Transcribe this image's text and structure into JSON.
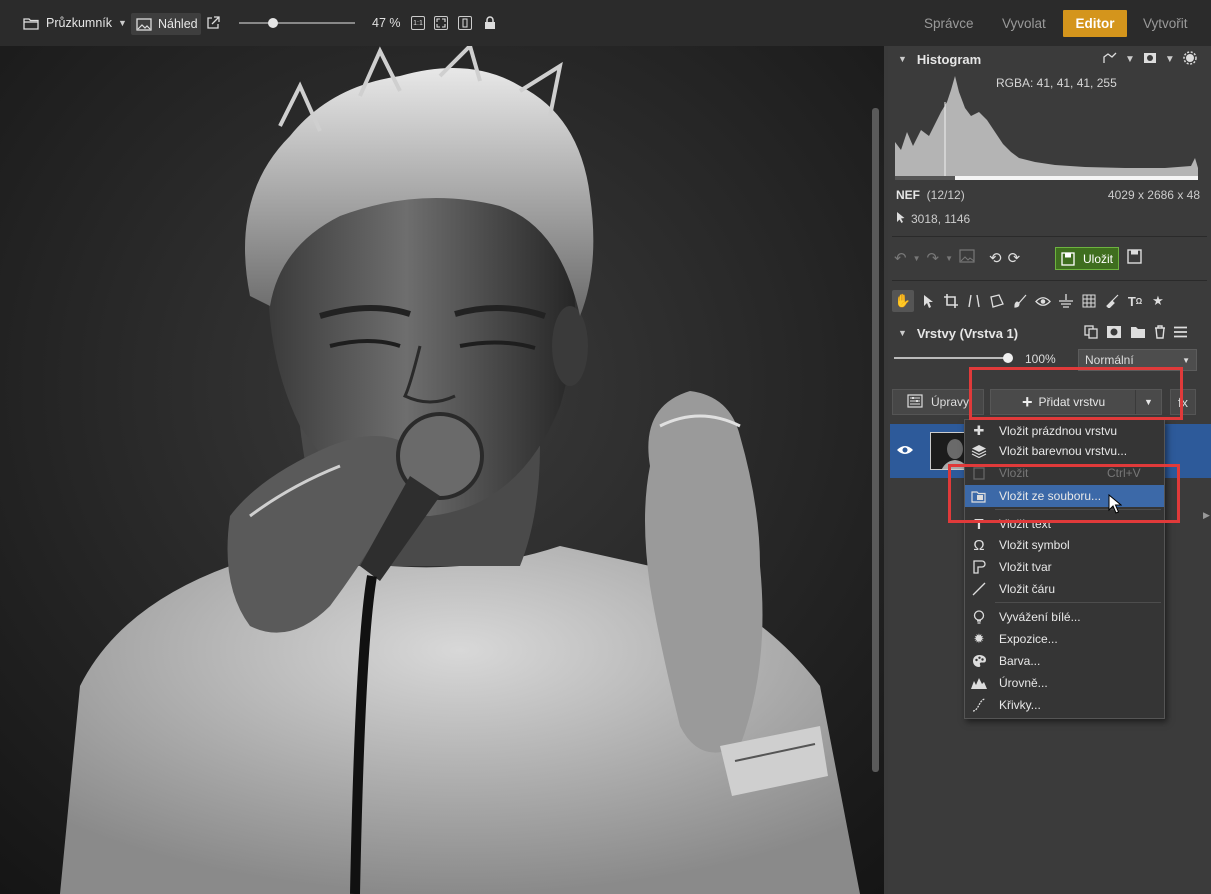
{
  "topbar": {
    "explorer_label": "Průzkumník",
    "preview_label": "Náhled",
    "zoom_value": "47 %",
    "zoom_fraction": 0.3,
    "fit_1to1_label": "1:1",
    "nav": {
      "manager": "Správce",
      "develop": "Vyvolat",
      "editor": "Editor",
      "create": "Vytvořit"
    },
    "accent_color": "#d4951c"
  },
  "histogram": {
    "title": "Histogram",
    "rgba": "RGBA:  41,  41,  41, 255",
    "format": "NEF",
    "index": "(12/12)",
    "dimensions": "4029 x 2686 x 48",
    "cursor_coords": "3018, 1146"
  },
  "history": {
    "save_label": "Uložit",
    "save_color": "#3f6e1f"
  },
  "layers": {
    "title": "Vrstvy (Vrstva 1)",
    "opacity_value": "100%",
    "opacity_fraction": 1.0,
    "blend_mode": "Normální",
    "adjust_label": "Úpravy",
    "add_layer_label": "Přidat vrstvu",
    "fx_label": "fx"
  },
  "menu": {
    "items": [
      {
        "label": "Vložit prázdnou vrstvu",
        "icon": "empty-layer-icon",
        "disabled": false
      },
      {
        "label": "Vložit barevnou vrstvu...",
        "icon": "color-layer-icon",
        "disabled": false
      },
      {
        "label": "Vložit",
        "icon": "paste-icon",
        "disabled": true,
        "shortcut": "Ctrl+V"
      },
      {
        "label": "Vložit ze souboru...",
        "icon": "from-file-icon",
        "disabled": false,
        "highlighted": true
      },
      {
        "label": "Vložit text",
        "icon": "text-icon",
        "disabled": false
      },
      {
        "label": "Vložit symbol",
        "icon": "omega-icon",
        "disabled": false
      },
      {
        "label": "Vložit tvar",
        "icon": "shape-icon",
        "disabled": false
      },
      {
        "label": "Vložit čáru",
        "icon": "line-icon",
        "disabled": false
      },
      {
        "label": "Vyvážení bílé...",
        "icon": "bulb-icon",
        "disabled": false
      },
      {
        "label": "Expozice...",
        "icon": "sun-icon",
        "disabled": false
      },
      {
        "label": "Barva...",
        "icon": "palette-icon",
        "disabled": false
      },
      {
        "label": "Úrovně...",
        "icon": "levels-icon",
        "disabled": false
      },
      {
        "label": "Křivky...",
        "icon": "curves-icon",
        "disabled": false
      }
    ],
    "highlight_color": "#3c69a8"
  },
  "annotation_color": "#e03a3a"
}
